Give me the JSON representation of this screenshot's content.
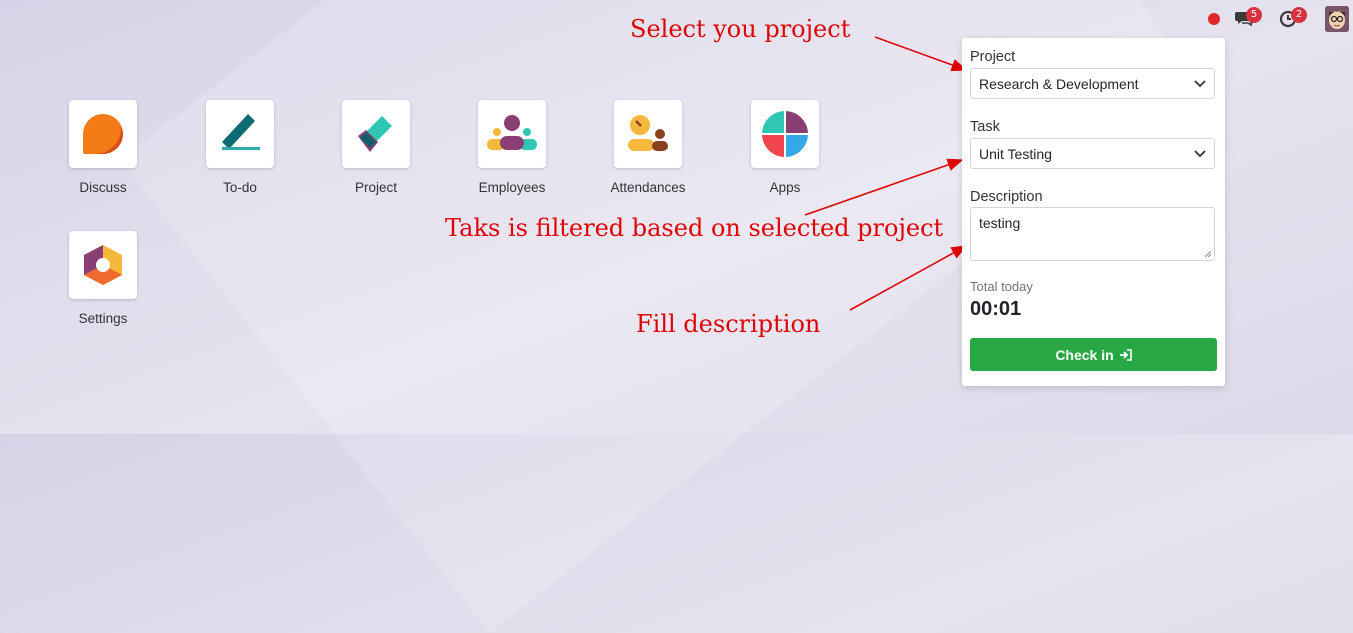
{
  "topbar": {
    "status_color": "#e0282e",
    "messages_count": "5",
    "activities_count": "2",
    "icons": [
      "status-dot",
      "chat-icon",
      "clock-icon",
      "avatar"
    ]
  },
  "apps": [
    {
      "label": "Discuss",
      "icon": "discuss-icon"
    },
    {
      "label": "To-do",
      "icon": "todo-icon"
    },
    {
      "label": "Project",
      "icon": "project-icon"
    },
    {
      "label": "Employees",
      "icon": "employees-icon"
    },
    {
      "label": "Attendances",
      "icon": "attendances-icon"
    },
    {
      "label": "Apps",
      "icon": "apps-icon"
    },
    {
      "label": "Settings",
      "icon": "settings-icon"
    }
  ],
  "annotations": {
    "select_project": "Select you project",
    "task_filtered": "Taks is filtered based on selected project",
    "fill_description": "Fill description",
    "color": "#e00000"
  },
  "panel": {
    "project_label": "Project",
    "project_value": "Research & Development",
    "task_label": "Task",
    "task_value": "Unit Testing",
    "description_label": "Description",
    "description_value": "testing",
    "total_label": "Total today",
    "total_value": "00:01",
    "checkin_label": "Check in",
    "checkin_color": "#28a745"
  }
}
